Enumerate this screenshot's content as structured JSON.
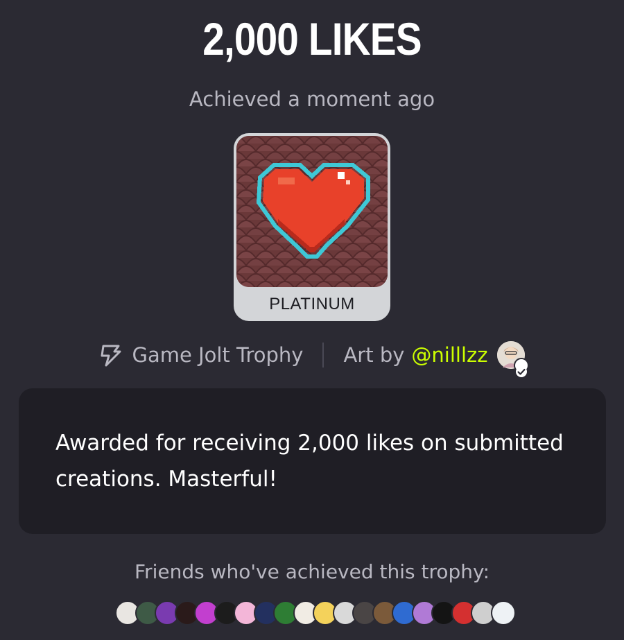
{
  "trophy": {
    "title": "2,000 LIKES",
    "achieved": "Achieved a moment ago",
    "level": "PLATINUM",
    "image_icon": "pixel-heart-icon"
  },
  "meta": {
    "source_icon": "game-jolt-bolt-icon",
    "source": "Game Jolt Trophy",
    "art_by_label": "Art by",
    "artist_handle": "@nilllzz",
    "handle_color": "#ccff00"
  },
  "description": "Awarded for receiving 2,000 likes on submitted creations. Masterful!",
  "friends": {
    "label": "Friends who've achieved this trophy:",
    "avatars": [
      {
        "color": "#e9e6e2"
      },
      {
        "color": "#3e5a46"
      },
      {
        "color": "#7a3bb0"
      },
      {
        "color": "#2a1a1a"
      },
      {
        "color": "#c23fcf"
      },
      {
        "color": "#1c1c1c"
      },
      {
        "color": "#f3b6d8"
      },
      {
        "color": "#23305f"
      },
      {
        "color": "#2e7d34"
      },
      {
        "color": "#f1ece4"
      },
      {
        "color": "#f4d25b"
      },
      {
        "color": "#d9d9d9"
      },
      {
        "color": "#4a4545"
      },
      {
        "color": "#7b5a3a"
      },
      {
        "color": "#2f6bd1"
      },
      {
        "color": "#b07ad6"
      },
      {
        "color": "#141414"
      },
      {
        "color": "#d43030"
      },
      {
        "color": "#cfcfcf"
      },
      {
        "color": "#eef2f5"
      }
    ]
  },
  "colors": {
    "background": "#2b2a33",
    "card": "#1f1e25",
    "muted_text": "#b9b8c2"
  }
}
